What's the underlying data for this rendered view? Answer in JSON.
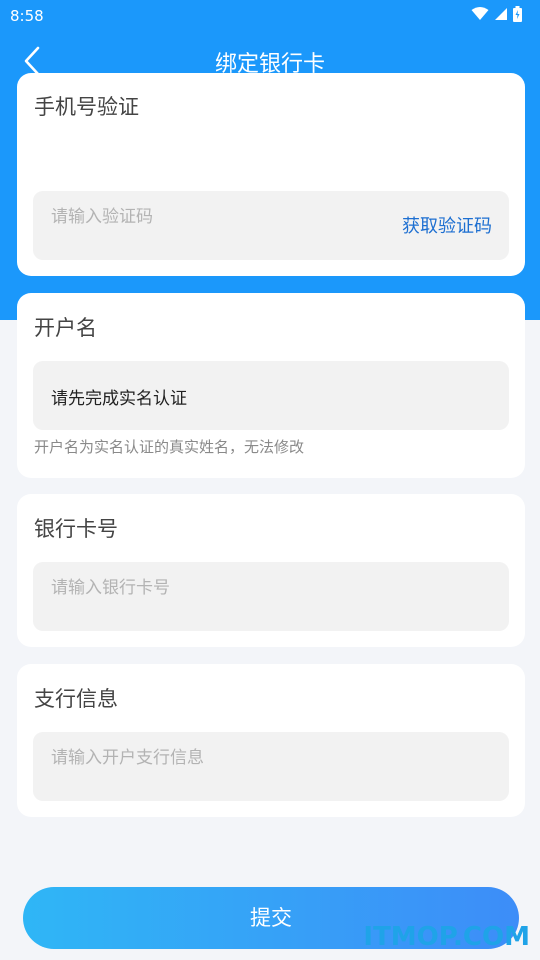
{
  "status_bar": {
    "time": "8:58"
  },
  "nav": {
    "title": "绑定银行卡"
  },
  "phone_card": {
    "label": "手机号验证",
    "code_placeholder": "请输入验证码",
    "get_code_label": "获取验证码"
  },
  "name_card": {
    "label": "开户名",
    "value": "请先完成实名认证",
    "hint": "开户名为实名认证的真实姓名，无法修改"
  },
  "bank_card": {
    "label": "银行卡号",
    "placeholder": "请输入银行卡号"
  },
  "branch_card": {
    "label": "支行信息",
    "placeholder": "请输入开户支行信息"
  },
  "submit": {
    "label": "提交"
  },
  "watermark": {
    "text": "ITMOP.COM"
  },
  "icons": {
    "back": "chevron-left-icon",
    "wifi": "wifi-icon",
    "signal": "signal-icon",
    "battery": "battery-icon"
  },
  "colors": {
    "header": "#1b98fb",
    "link": "#1d6fd1",
    "button_start": "#2fb6f6",
    "button_end": "#3d8df8"
  }
}
